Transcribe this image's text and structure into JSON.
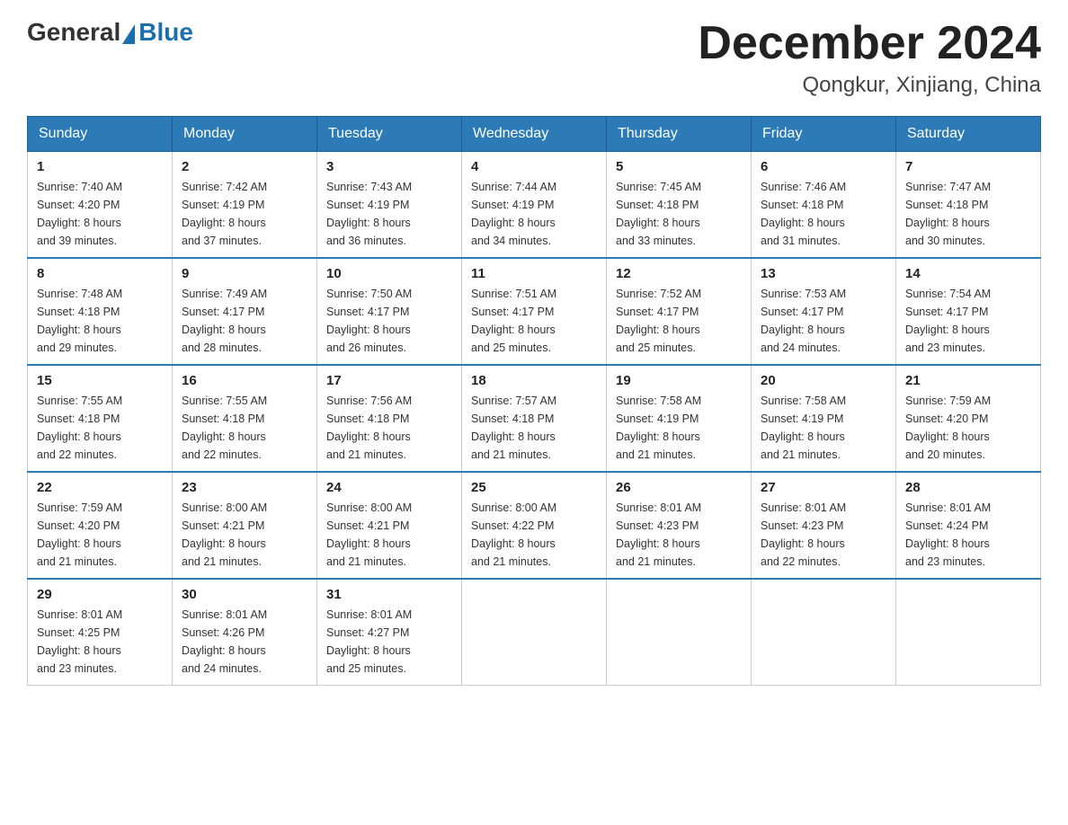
{
  "logo": {
    "general": "General",
    "blue": "Blue"
  },
  "title": "December 2024",
  "location": "Qongkur, Xinjiang, China",
  "days_of_week": [
    "Sunday",
    "Monday",
    "Tuesday",
    "Wednesday",
    "Thursday",
    "Friday",
    "Saturday"
  ],
  "weeks": [
    [
      {
        "day": "1",
        "sunrise": "7:40 AM",
        "sunset": "4:20 PM",
        "daylight": "8 hours and 39 minutes."
      },
      {
        "day": "2",
        "sunrise": "7:42 AM",
        "sunset": "4:19 PM",
        "daylight": "8 hours and 37 minutes."
      },
      {
        "day": "3",
        "sunrise": "7:43 AM",
        "sunset": "4:19 PM",
        "daylight": "8 hours and 36 minutes."
      },
      {
        "day": "4",
        "sunrise": "7:44 AM",
        "sunset": "4:19 PM",
        "daylight": "8 hours and 34 minutes."
      },
      {
        "day": "5",
        "sunrise": "7:45 AM",
        "sunset": "4:18 PM",
        "daylight": "8 hours and 33 minutes."
      },
      {
        "day": "6",
        "sunrise": "7:46 AM",
        "sunset": "4:18 PM",
        "daylight": "8 hours and 31 minutes."
      },
      {
        "day": "7",
        "sunrise": "7:47 AM",
        "sunset": "4:18 PM",
        "daylight": "8 hours and 30 minutes."
      }
    ],
    [
      {
        "day": "8",
        "sunrise": "7:48 AM",
        "sunset": "4:18 PM",
        "daylight": "8 hours and 29 minutes."
      },
      {
        "day": "9",
        "sunrise": "7:49 AM",
        "sunset": "4:17 PM",
        "daylight": "8 hours and 28 minutes."
      },
      {
        "day": "10",
        "sunrise": "7:50 AM",
        "sunset": "4:17 PM",
        "daylight": "8 hours and 26 minutes."
      },
      {
        "day": "11",
        "sunrise": "7:51 AM",
        "sunset": "4:17 PM",
        "daylight": "8 hours and 25 minutes."
      },
      {
        "day": "12",
        "sunrise": "7:52 AM",
        "sunset": "4:17 PM",
        "daylight": "8 hours and 25 minutes."
      },
      {
        "day": "13",
        "sunrise": "7:53 AM",
        "sunset": "4:17 PM",
        "daylight": "8 hours and 24 minutes."
      },
      {
        "day": "14",
        "sunrise": "7:54 AM",
        "sunset": "4:17 PM",
        "daylight": "8 hours and 23 minutes."
      }
    ],
    [
      {
        "day": "15",
        "sunrise": "7:55 AM",
        "sunset": "4:18 PM",
        "daylight": "8 hours and 22 minutes."
      },
      {
        "day": "16",
        "sunrise": "7:55 AM",
        "sunset": "4:18 PM",
        "daylight": "8 hours and 22 minutes."
      },
      {
        "day": "17",
        "sunrise": "7:56 AM",
        "sunset": "4:18 PM",
        "daylight": "8 hours and 21 minutes."
      },
      {
        "day": "18",
        "sunrise": "7:57 AM",
        "sunset": "4:18 PM",
        "daylight": "8 hours and 21 minutes."
      },
      {
        "day": "19",
        "sunrise": "7:58 AM",
        "sunset": "4:19 PM",
        "daylight": "8 hours and 21 minutes."
      },
      {
        "day": "20",
        "sunrise": "7:58 AM",
        "sunset": "4:19 PM",
        "daylight": "8 hours and 21 minutes."
      },
      {
        "day": "21",
        "sunrise": "7:59 AM",
        "sunset": "4:20 PM",
        "daylight": "8 hours and 20 minutes."
      }
    ],
    [
      {
        "day": "22",
        "sunrise": "7:59 AM",
        "sunset": "4:20 PM",
        "daylight": "8 hours and 21 minutes."
      },
      {
        "day": "23",
        "sunrise": "8:00 AM",
        "sunset": "4:21 PM",
        "daylight": "8 hours and 21 minutes."
      },
      {
        "day": "24",
        "sunrise": "8:00 AM",
        "sunset": "4:21 PM",
        "daylight": "8 hours and 21 minutes."
      },
      {
        "day": "25",
        "sunrise": "8:00 AM",
        "sunset": "4:22 PM",
        "daylight": "8 hours and 21 minutes."
      },
      {
        "day": "26",
        "sunrise": "8:01 AM",
        "sunset": "4:23 PM",
        "daylight": "8 hours and 21 minutes."
      },
      {
        "day": "27",
        "sunrise": "8:01 AM",
        "sunset": "4:23 PM",
        "daylight": "8 hours and 22 minutes."
      },
      {
        "day": "28",
        "sunrise": "8:01 AM",
        "sunset": "4:24 PM",
        "daylight": "8 hours and 23 minutes."
      }
    ],
    [
      {
        "day": "29",
        "sunrise": "8:01 AM",
        "sunset": "4:25 PM",
        "daylight": "8 hours and 23 minutes."
      },
      {
        "day": "30",
        "sunrise": "8:01 AM",
        "sunset": "4:26 PM",
        "daylight": "8 hours and 24 minutes."
      },
      {
        "day": "31",
        "sunrise": "8:01 AM",
        "sunset": "4:27 PM",
        "daylight": "8 hours and 25 minutes."
      },
      null,
      null,
      null,
      null
    ]
  ],
  "labels": {
    "sunrise": "Sunrise:",
    "sunset": "Sunset:",
    "daylight": "Daylight:"
  }
}
